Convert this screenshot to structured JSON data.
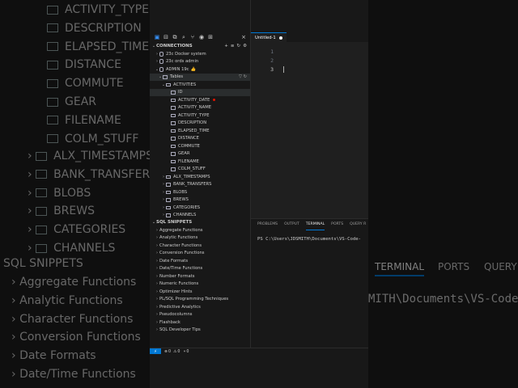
{
  "bg": {
    "left_items": [
      "ACTIVITY_TYPE",
      "DESCRIPTION",
      "ELAPSED_TIME",
      "DISTANCE",
      "COMMUTE",
      "GEAR",
      "FILENAME",
      "COLM_STUFF"
    ],
    "left_tables": [
      "ALX_TIMESTAMPS",
      "BANK_TRANSFERS",
      "BLOBS",
      "BREWS",
      "CATEGORIES",
      "CHANNELS"
    ],
    "left_snippets_header": "SQL SNIPPETS",
    "left_snippets": [
      "Aggregate Functions",
      "Analytic Functions",
      "Character Functions",
      "Conversion Functions",
      "Date Formats",
      "Date/Time Functions"
    ],
    "right_tabs": [
      "TERMINAL",
      "PORTS",
      "QUERY R"
    ],
    "right_path": "MITH\\Documents\\VS-Code-"
  },
  "toolbar": {
    "icons": [
      "files-icon",
      "database-icon",
      "copy-icon",
      "search-icon",
      "source-control-icon",
      "run-debug-icon",
      "extensions-icon",
      "close-icon"
    ]
  },
  "connections": {
    "header": "CONNECTIONS",
    "items": [
      "23c Docker system",
      "23c ords admin",
      "ADMIN 19c"
    ],
    "admin_suffix": "👍",
    "tables_label": "Tables",
    "activities_label": "ACTIVITIES",
    "columns": [
      "ID",
      "ACTIVITY_DATE",
      "ACTIVITY_NAME",
      "ACTIVITY_TYPE",
      "DESCRIPTION",
      "ELAPSED_TIME",
      "DISTANCE",
      "COMMUTE",
      "GEAR",
      "FILENAME",
      "COLM_STUFF"
    ],
    "tables": [
      "ALX_TIMESTAMPS",
      "BANK_TRANSFERS",
      "BLOBS",
      "BREWS",
      "CATEGORIES",
      "CHANNELS"
    ]
  },
  "snippets": {
    "header": "SQL SNIPPETS",
    "items": [
      "Aggregate Functions",
      "Analytic Functions",
      "Character Functions",
      "Conversion Functions",
      "Date Formats",
      "Date/Time Functions",
      "Number Formats",
      "Numeric Functions",
      "Optimizer Hints",
      "PL/SQL Programming Techniques",
      "Predictive Analytics",
      "Pseudocolumns",
      "Flashback",
      "SQL Developer Tips"
    ]
  },
  "editor": {
    "tab_title": "Untitled-1",
    "line_numbers": [
      "1",
      "2",
      "3"
    ]
  },
  "panel": {
    "tabs": [
      "PROBLEMS",
      "OUTPUT",
      "TERMINAL",
      "PORTS",
      "QUERY R"
    ],
    "terminal_text": "PS C:\\Users\\JDSMITH\\Documents\\VS-Code-"
  },
  "status": {
    "errors": "0",
    "warnings": "0",
    "ports": "0"
  }
}
